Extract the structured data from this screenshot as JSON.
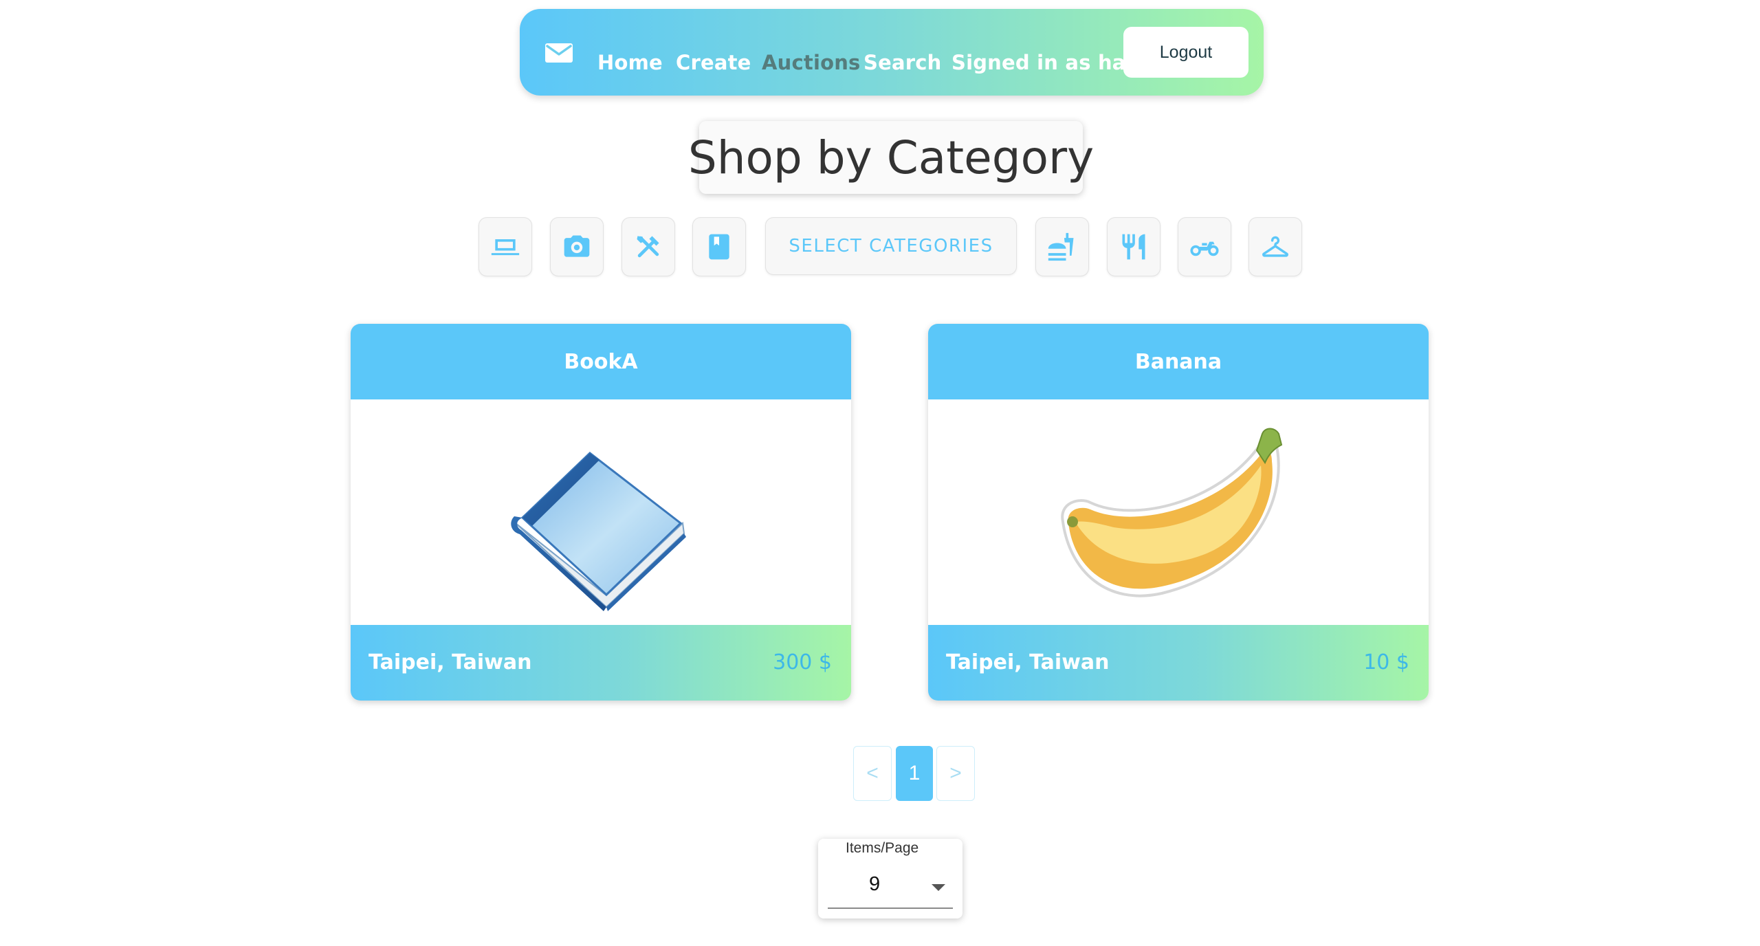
{
  "nav": {
    "home": "Home",
    "create": "Create",
    "auctions": "Auctions",
    "search": "Search",
    "signed_in": "Signed in as hans",
    "logout": "Logout",
    "mail_icon": "mail-icon"
  },
  "heading": "Shop by Category",
  "categories": {
    "icons": [
      "laptop-icon",
      "camera-icon",
      "tools-icon",
      "book-icon",
      "fastfood-icon",
      "restaurant-icon",
      "motorcycle-icon",
      "hanger-icon"
    ],
    "select_label": "SELECT CATEGORIES"
  },
  "cards": [
    {
      "title": "BookA",
      "location": "Taipei, Taiwan",
      "price": "300 $",
      "image": "book-image"
    },
    {
      "title": "Banana",
      "location": "Taipei, Taiwan",
      "price": "10 $",
      "image": "banana-image"
    }
  ],
  "pagination": {
    "prev": "<",
    "current": "1",
    "next": ">"
  },
  "items_per_page": {
    "label": "Items/Page",
    "value": "9"
  },
  "colors": {
    "accent": "#5bc7f9",
    "gradient_end": "#a6f5a6",
    "price_text": "#3db8e8",
    "heading_text": "#333333"
  }
}
